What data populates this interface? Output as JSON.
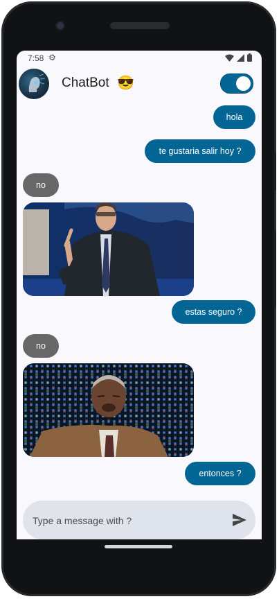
{
  "status_bar": {
    "time": "7:58"
  },
  "header": {
    "title": "ChatBot",
    "emoji": "😎",
    "toggle_on": true
  },
  "colors": {
    "accent": "#036594",
    "received": "#676767",
    "background": "#f9f8fd",
    "input_bg": "#dfe3ec"
  },
  "messages": [
    {
      "type": "sent",
      "text": "hola"
    },
    {
      "type": "sent",
      "text": "te gustaria salir hoy ?"
    },
    {
      "type": "received",
      "text": "no"
    },
    {
      "type": "gif",
      "subject": "man-in-suit-pointing"
    },
    {
      "type": "sent",
      "text": "estas seguro ?"
    },
    {
      "type": "received",
      "text": "no"
    },
    {
      "type": "gif",
      "subject": "man-laughing-lights"
    },
    {
      "type": "sent",
      "text": "entonces ?"
    }
  ],
  "composer": {
    "placeholder": "Type a message with ?",
    "send_icon": "send-icon"
  }
}
